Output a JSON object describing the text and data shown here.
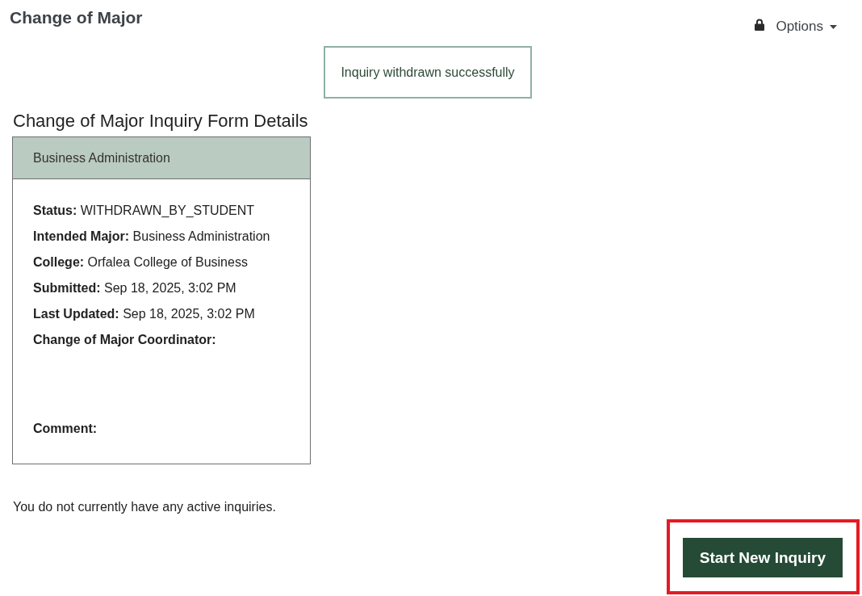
{
  "page": {
    "title": "Change of Major"
  },
  "options_menu": {
    "label": "Options"
  },
  "alert": {
    "message": "Inquiry withdrawn successfully"
  },
  "details": {
    "heading": "Change of Major Inquiry Form Details",
    "card": {
      "title": "Business Administration",
      "fields": [
        {
          "kind": "line",
          "label": "Status:",
          "value": "WITHDRAWN_BY_STUDENT"
        },
        {
          "kind": "line",
          "label": "Intended Major:",
          "value": "Business Administration"
        },
        {
          "kind": "line",
          "label": "College:",
          "value": "Orfalea College of Business"
        },
        {
          "kind": "line",
          "label": "Submitted:",
          "value": "Sep 18, 2025, 3:02 PM"
        },
        {
          "kind": "line",
          "label": "Last Updated:",
          "value": "Sep 18, 2025, 3:02 PM"
        },
        {
          "kind": "block",
          "label": "Change of Major Coordinator:"
        },
        {
          "kind": "line",
          "label": "Comment:"
        }
      ]
    }
  },
  "empty_message": "You do not currently have any active inquiries.",
  "start_button": {
    "label": "Start New Inquiry",
    "highlighted": true
  }
}
